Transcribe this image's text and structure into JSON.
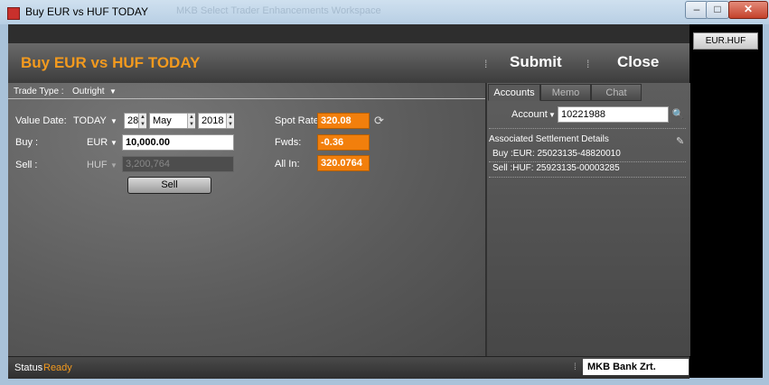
{
  "window": {
    "title": "Buy EUR vs HUF TODAY",
    "ghost_title": "MKB Select Trader Enhancements Workspace",
    "min": "–",
    "max": "□",
    "close": "✕"
  },
  "pair_tab": "EUR.HUF",
  "header": {
    "title": "Buy EUR vs HUF TODAY",
    "submit": "Submit",
    "close": "Close"
  },
  "trade_type": {
    "label": "Trade Type :",
    "value": "Outright"
  },
  "value_date": {
    "label": "Value Date:",
    "tenor": "TODAY",
    "day": "28",
    "month": "May",
    "year": "2018"
  },
  "buy": {
    "label": "Buy :",
    "currency": "EUR",
    "amount": "10,000.00"
  },
  "sell": {
    "label": "Sell :",
    "currency": "HUF",
    "amount": "3,200,764",
    "button": "Sell"
  },
  "rates": {
    "spot_label": "Spot Rate:",
    "spot": "320.08",
    "fwds_label": "Fwds:",
    "fwds": "-0.36",
    "allin_label": "All In:",
    "allin": "320.0764"
  },
  "tabs": [
    {
      "label": "Accounts"
    },
    {
      "label": "Memo"
    },
    {
      "label": "Chat"
    }
  ],
  "account": {
    "label": "Account",
    "value": "10221988"
  },
  "settlement": {
    "title": "Associated Settlement Details",
    "buy_line": "Buy :EUR: 25023135-48820010",
    "sell_line": "Sell :HUF: 25923135-00003285"
  },
  "status": {
    "label": "Status",
    "value": "Ready"
  },
  "bank": "MKB Bank Zrt."
}
